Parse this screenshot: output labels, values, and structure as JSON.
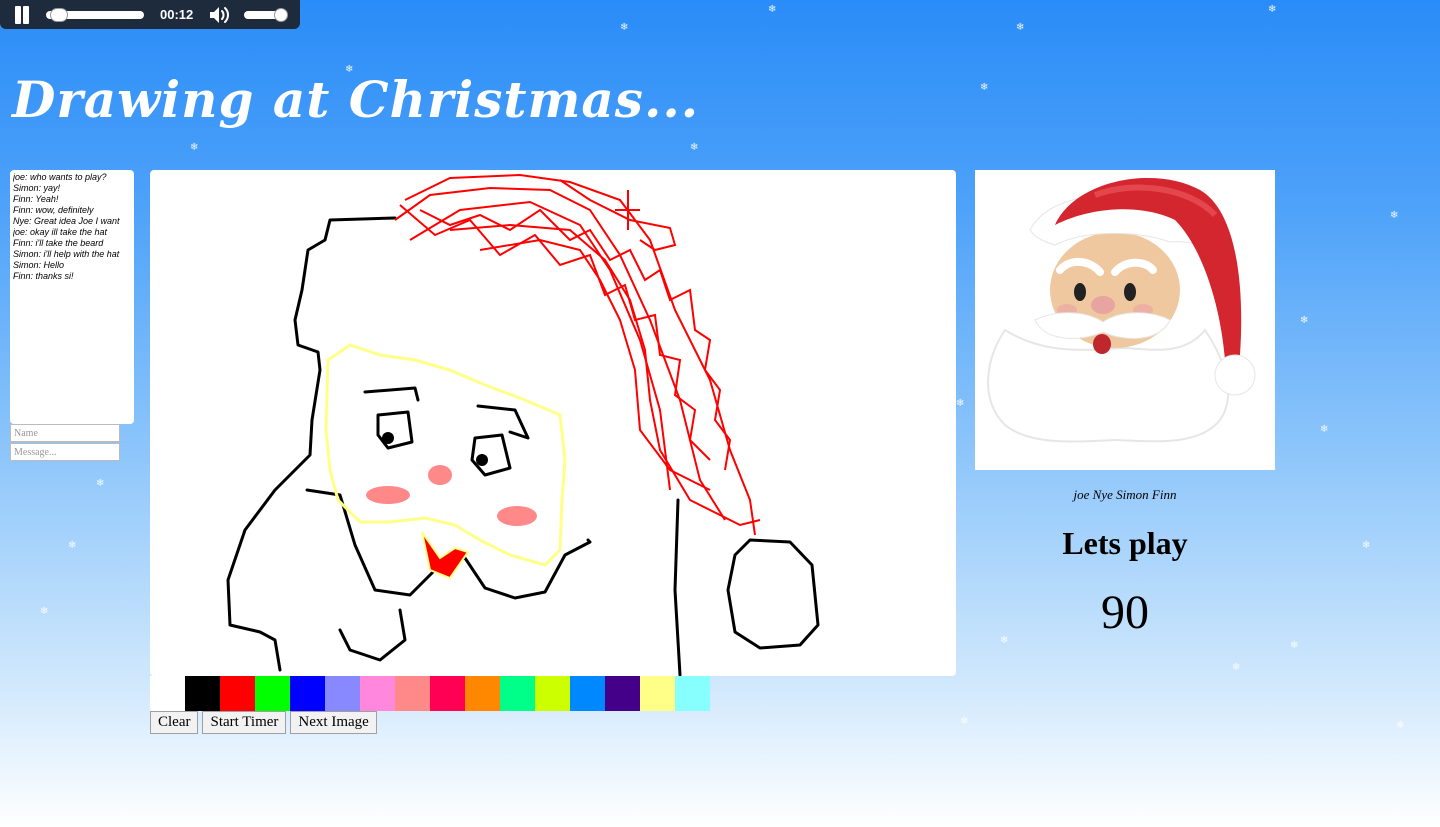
{
  "audio_player": {
    "time": "00:12",
    "progress": 0.05,
    "volume": 1.0
  },
  "title": "Drawing at Christmas...",
  "chat": {
    "messages": [
      "joe: who wants to play?",
      "Simon: yay!",
      "Finn: Yeah!",
      "Finn: wow, definitely",
      "Nye: Great idea Joe I want",
      "joe: okay ill take the hat",
      "Finn: i'll take the beard",
      "Simon: i'll help with the hat",
      "Simon: Hello",
      "Finn: thanks si!"
    ],
    "name_placeholder": "Name",
    "message_placeholder": "Message..."
  },
  "palette": [
    "#ffffff",
    "#000000",
    "#ff0000",
    "#00ff00",
    "#0000ff",
    "#8888ff",
    "#ff88dd",
    "#ff8888",
    "#ff0055",
    "#ff8800",
    "#00ff88",
    "#ccff00",
    "#0088ff",
    "#440088",
    "#ffff88",
    "#88ffff"
  ],
  "buttons": {
    "clear": "Clear",
    "start_timer": "Start Timer",
    "next_image": "Next Image"
  },
  "players": "joe Nye Simon Finn",
  "status": "Lets play",
  "timer": "90"
}
